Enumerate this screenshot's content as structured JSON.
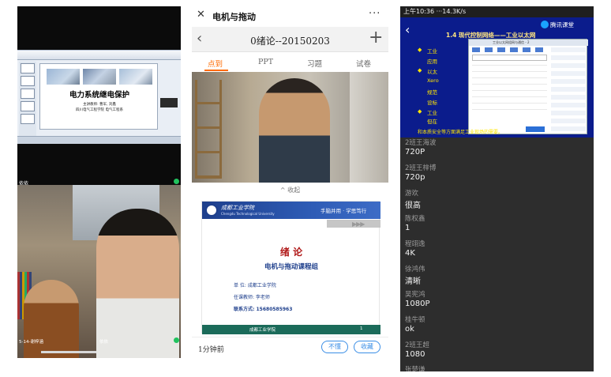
{
  "panel_a": {
    "slide": {
      "title": "电力系统继电保护",
      "subtitle1": "主讲教师: 曹军, 刘鑫",
      "subtitle2": "四川电气工程学院 电气工程系"
    },
    "participants": {
      "top_name": "依依",
      "bottom_left_name": "5-14-谢梓涵",
      "bottom_right_name": "依依"
    }
  },
  "panel_b": {
    "window_title": "电机与拖动",
    "lesson_title": "0绪论--20150203",
    "tabs": [
      "点到",
      "PPT",
      "习题",
      "试卷"
    ],
    "collapse_label": "^ 收起",
    "ppt": {
      "school": "成都工业学院",
      "school_en": "Chengdu Technological University",
      "motto": "手脑并用 · 学思笃行",
      "title": "绪  论",
      "subtitle": "电机与拖动课程组",
      "unit": "单    位: 成都工业学院",
      "teacher": "任课教师: 李老师",
      "contact": "联系方式: 15680585963",
      "footer": "成都工业学院",
      "page": "1"
    },
    "timer": "1分钟前",
    "buttons": {
      "dislike": "不懂",
      "favorite": "收藏"
    }
  },
  "panel_c": {
    "status_bar": "上午10:36 ···14.3K/s",
    "app_name": "腾讯课堂",
    "slide": {
      "title": "1.4 现代控制网络——工业以太网",
      "bullets": [
        {
          "mark": "◆",
          "text": "工业"
        },
        {
          "mark": "",
          "text": "应用"
        },
        {
          "mark": "◆",
          "text": "以太"
        },
        {
          "mark": "",
          "text": "Xero"
        },
        {
          "mark": "",
          "text": "规范"
        },
        {
          "mark": "",
          "text": "设标"
        },
        {
          "mark": "◆",
          "text": "工业"
        },
        {
          "mark": "",
          "text": "但在"
        },
        {
          "mark": "",
          "text": "性以"
        }
      ],
      "footer_line": "和本质安全等方面满足工业现场的需要。",
      "inner_window_title": "工业以太网组网与通信 - 2"
    },
    "chat": [
      {
        "name": "2班王海波",
        "msg": "720P"
      },
      {
        "name": "2班王梓博",
        "msg": "720p"
      },
      {
        "name": "游欢",
        "msg": "很高"
      },
      {
        "name": "陈权鑫",
        "msg": "1"
      },
      {
        "name": "程翊逸",
        "msg": "4K"
      },
      {
        "name": "徐鸿伟",
        "msg": "清晰"
      },
      {
        "name": "吴宪鸿",
        "msg": "1080P"
      },
      {
        "name": "桂牛顿",
        "msg": "ok"
      },
      {
        "name": "2班王超",
        "msg": "1080"
      },
      {
        "name": "张楚谦",
        "msg": ""
      }
    ]
  }
}
